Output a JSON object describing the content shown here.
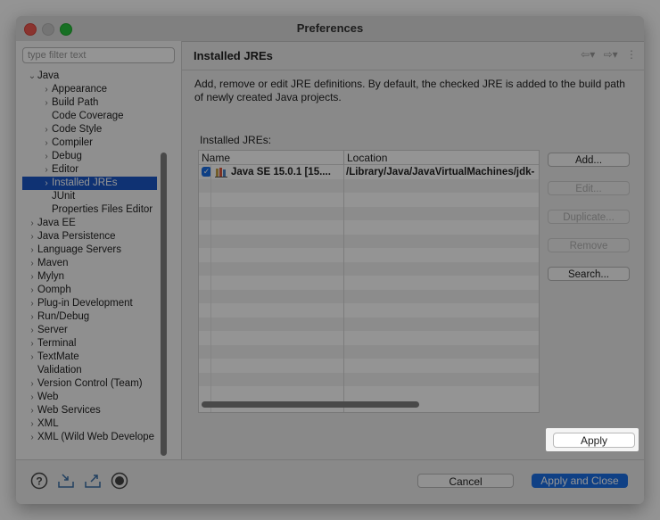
{
  "window": {
    "title": "Preferences"
  },
  "filter": {
    "placeholder": "type filter text"
  },
  "tree": [
    {
      "label": "Java",
      "level": 0,
      "arrow": "open"
    },
    {
      "label": "Appearance",
      "level": 1,
      "arrow": "closed"
    },
    {
      "label": "Build Path",
      "level": 1,
      "arrow": "closed"
    },
    {
      "label": "Code Coverage",
      "level": 1,
      "arrow": "none"
    },
    {
      "label": "Code Style",
      "level": 1,
      "arrow": "closed"
    },
    {
      "label": "Compiler",
      "level": 1,
      "arrow": "closed"
    },
    {
      "label": "Debug",
      "level": 1,
      "arrow": "closed"
    },
    {
      "label": "Editor",
      "level": 1,
      "arrow": "closed"
    },
    {
      "label": "Installed JREs",
      "level": 1,
      "arrow": "closed",
      "selected": true
    },
    {
      "label": "JUnit",
      "level": 1,
      "arrow": "none"
    },
    {
      "label": "Properties Files Editor",
      "level": 1,
      "arrow": "none"
    },
    {
      "label": "Java EE",
      "level": 0,
      "arrow": "closed"
    },
    {
      "label": "Java Persistence",
      "level": 0,
      "arrow": "closed"
    },
    {
      "label": "Language Servers",
      "level": 0,
      "arrow": "closed"
    },
    {
      "label": "Maven",
      "level": 0,
      "arrow": "closed"
    },
    {
      "label": "Mylyn",
      "level": 0,
      "arrow": "closed"
    },
    {
      "label": "Oomph",
      "level": 0,
      "arrow": "closed"
    },
    {
      "label": "Plug-in Development",
      "level": 0,
      "arrow": "closed"
    },
    {
      "label": "Run/Debug",
      "level": 0,
      "arrow": "closed"
    },
    {
      "label": "Server",
      "level": 0,
      "arrow": "closed"
    },
    {
      "label": "Terminal",
      "level": 0,
      "arrow": "closed"
    },
    {
      "label": "TextMate",
      "level": 0,
      "arrow": "closed"
    },
    {
      "label": "Validation",
      "level": 0,
      "arrow": "none"
    },
    {
      "label": "Version Control (Team)",
      "level": 0,
      "arrow": "closed"
    },
    {
      "label": "Web",
      "level": 0,
      "arrow": "closed"
    },
    {
      "label": "Web Services",
      "level": 0,
      "arrow": "closed"
    },
    {
      "label": "XML",
      "level": 0,
      "arrow": "closed"
    },
    {
      "label": "XML (Wild Web Develope",
      "level": 0,
      "arrow": "closed"
    }
  ],
  "page": {
    "title": "Installed JREs",
    "description": "Add, remove or edit JRE definitions. By default, the checked JRE is added to the build path of newly created Java projects.",
    "jre_label": "Installed JREs:"
  },
  "table": {
    "columns": [
      "Name",
      "Location"
    ],
    "rows": [
      {
        "checked": true,
        "name": "Java SE 15.0.1 [15....",
        "location": "/Library/Java/JavaVirtualMachines/jdk-"
      }
    ]
  },
  "side_buttons": {
    "add": "Add...",
    "edit": "Edit...",
    "duplicate": "Duplicate...",
    "remove": "Remove",
    "search": "Search..."
  },
  "apply_label": "Apply",
  "footer": {
    "cancel": "Cancel",
    "apply_close": "Apply and Close"
  },
  "colors": {
    "accent": "#1b6ee6",
    "selection": "#1b57c7"
  }
}
